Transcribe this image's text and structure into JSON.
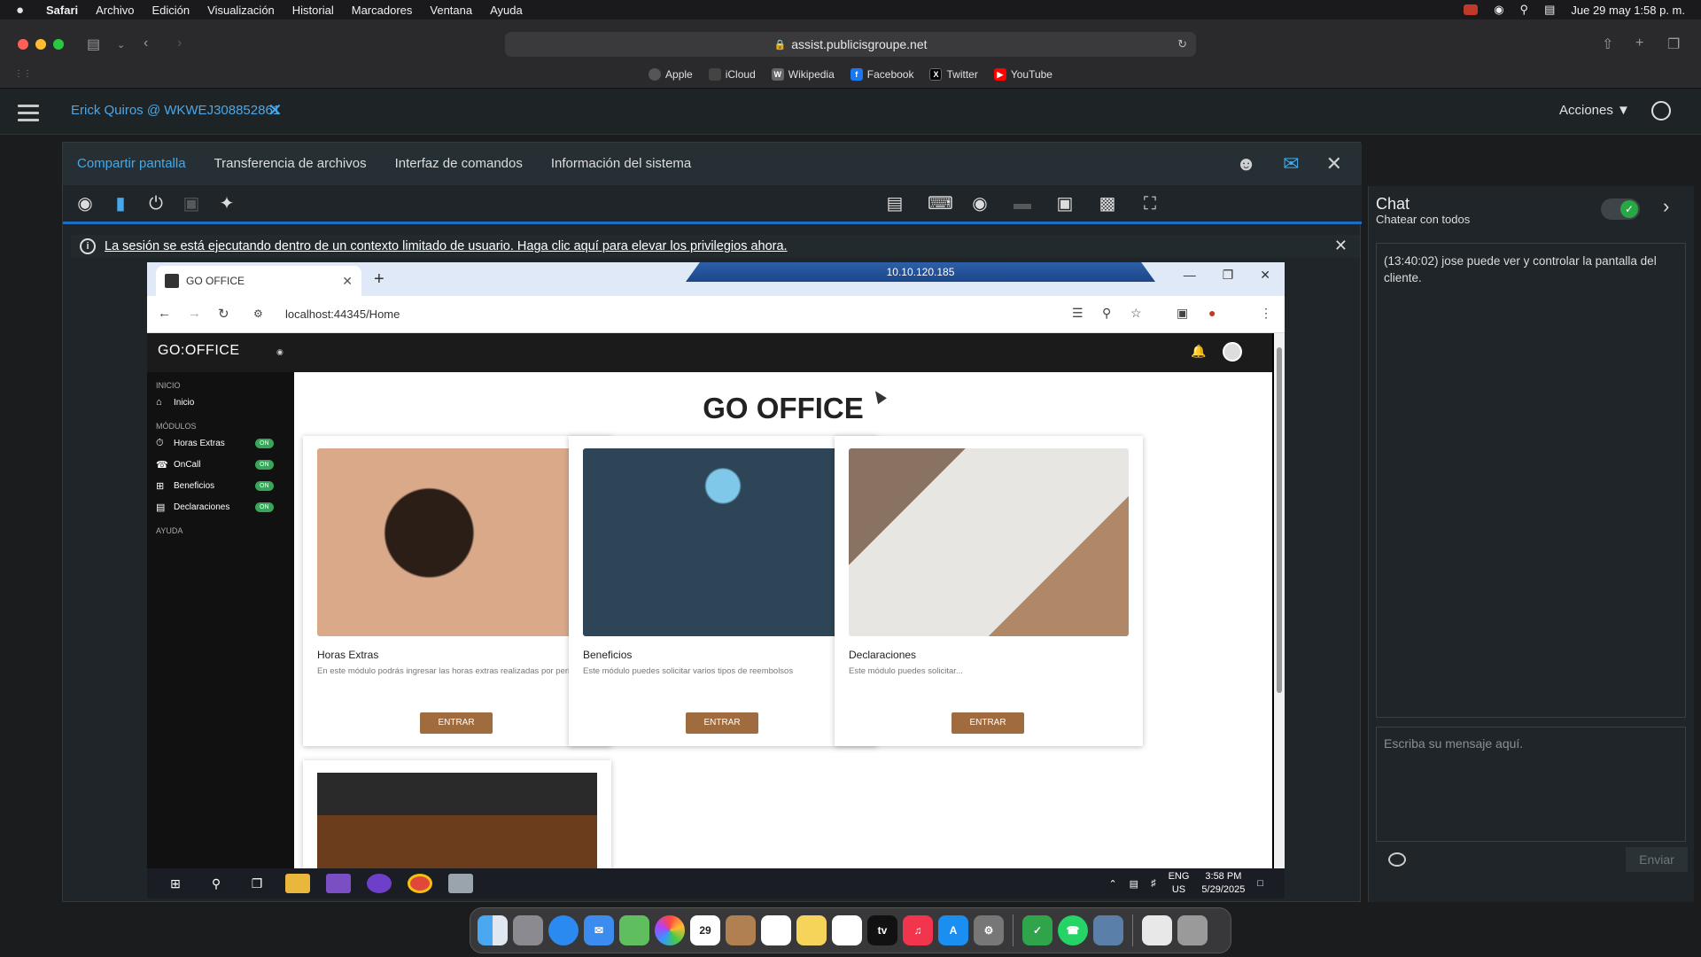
{
  "menubar": {
    "apple": "",
    "items": [
      "Safari",
      "Archivo",
      "Edición",
      "Visualización",
      "Historial",
      "Marcadores",
      "Ventana",
      "Ayuda"
    ],
    "datetime": "Jue 29 may  1:58 p. m."
  },
  "safari": {
    "url": "assist.publicisgroupe.net",
    "favorites": [
      "Apple",
      "iCloud",
      "Wikipedia",
      "Facebook",
      "Twitter",
      "YouTube"
    ]
  },
  "header": {
    "session_title": "Erick Quiros @ WKWEJ308852861",
    "acciones": "Acciones"
  },
  "tabs": [
    "Compartir pantalla",
    "Transferencia de archivos",
    "Interfaz de comandos",
    "Información del sistema"
  ],
  "banner": {
    "text": "La sesión se está ejecutando dentro de un contexto limitado de usuario. Haga clic aquí para elevar los privilegios ahora."
  },
  "remote": {
    "tab_title": "GO OFFICE",
    "rdp_ip": "10.10.120.185",
    "address": "localhost:44345/Home",
    "brand": "GO:OFFICE",
    "nav": {
      "section_inicio": "INICIO",
      "inicio": "Inicio",
      "section_modulos": "MÓDULOS",
      "items": [
        {
          "label": "Horas Extras",
          "badge": "ON"
        },
        {
          "label": "OnCall",
          "badge": "ON"
        },
        {
          "label": "Beneficios",
          "badge": "ON"
        },
        {
          "label": "Declaraciones",
          "badge": "ON"
        }
      ],
      "section_ayuda": "AYUDA"
    },
    "heading": "GO OFFICE",
    "cards": [
      {
        "title": "Horas Extras",
        "desc": "En este módulo podrás ingresar las horas extras realizadas por periodos.",
        "button": "ENTRAR"
      },
      {
        "title": "Beneficios",
        "desc": "Este módulo puedes solicitar varios tipos de reembolsos",
        "button": "ENTRAR"
      },
      {
        "title": "Declaraciones",
        "desc": "Este módulo puedes solicitar...",
        "button": "ENTRAR"
      }
    ],
    "tray": {
      "lang1": "ENG",
      "lang2": "US",
      "time": "3:58 PM",
      "date": "5/29/2025"
    }
  },
  "chat": {
    "title": "Chat",
    "subtitle": "Chatear con todos",
    "message": "(13:40:02) jose puede ver y controlar la pantalla del cliente.",
    "placeholder": "Escriba su mensaje aquí.",
    "send": "Enviar"
  },
  "colors": {
    "accent": "#44a8ea",
    "button": "#a06b3e",
    "badge": "#3aa55a"
  }
}
